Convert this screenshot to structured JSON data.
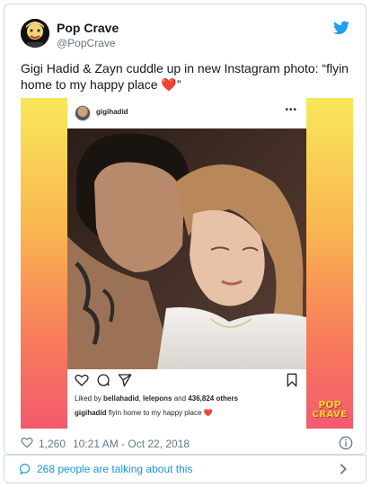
{
  "tweet": {
    "author_name": "Pop Crave",
    "author_handle": "@PopCrave",
    "text": "Gigi Hadid & Zayn cuddle up in new Instagram photo: “flyin home to my happy place ",
    "text_heart": "❤️",
    "text_end": "”",
    "likes": "1,260",
    "timestamp": "10:21 AM - Oct 22, 2018",
    "talking": "268 people are talking about this"
  },
  "instagram": {
    "username": "gigihadid",
    "more": "•••",
    "likes_prefix": "Liked by ",
    "likes_user1": "bellahadid",
    "likes_sep": ", ",
    "likes_user2": "lelepons",
    "likes_and": " and ",
    "likes_count": "436,824 others",
    "caption_user": "gigihadid",
    "caption_text": " flyin home to my happy place ",
    "caption_heart": "❤️"
  },
  "watermark": {
    "line1": "POP",
    "line2": "CRAVE"
  },
  "icons": {
    "twitter": "twitter-bird-icon",
    "like": "heart-icon",
    "info": "info-icon",
    "talk": "speech-bubble-icon",
    "chevron": "chevron-right-icon"
  },
  "colors": {
    "twitter_blue": "#1da1f2",
    "link_blue": "#1b95e0",
    "meta_gray": "#657786",
    "heart_red": "#e0245e"
  }
}
